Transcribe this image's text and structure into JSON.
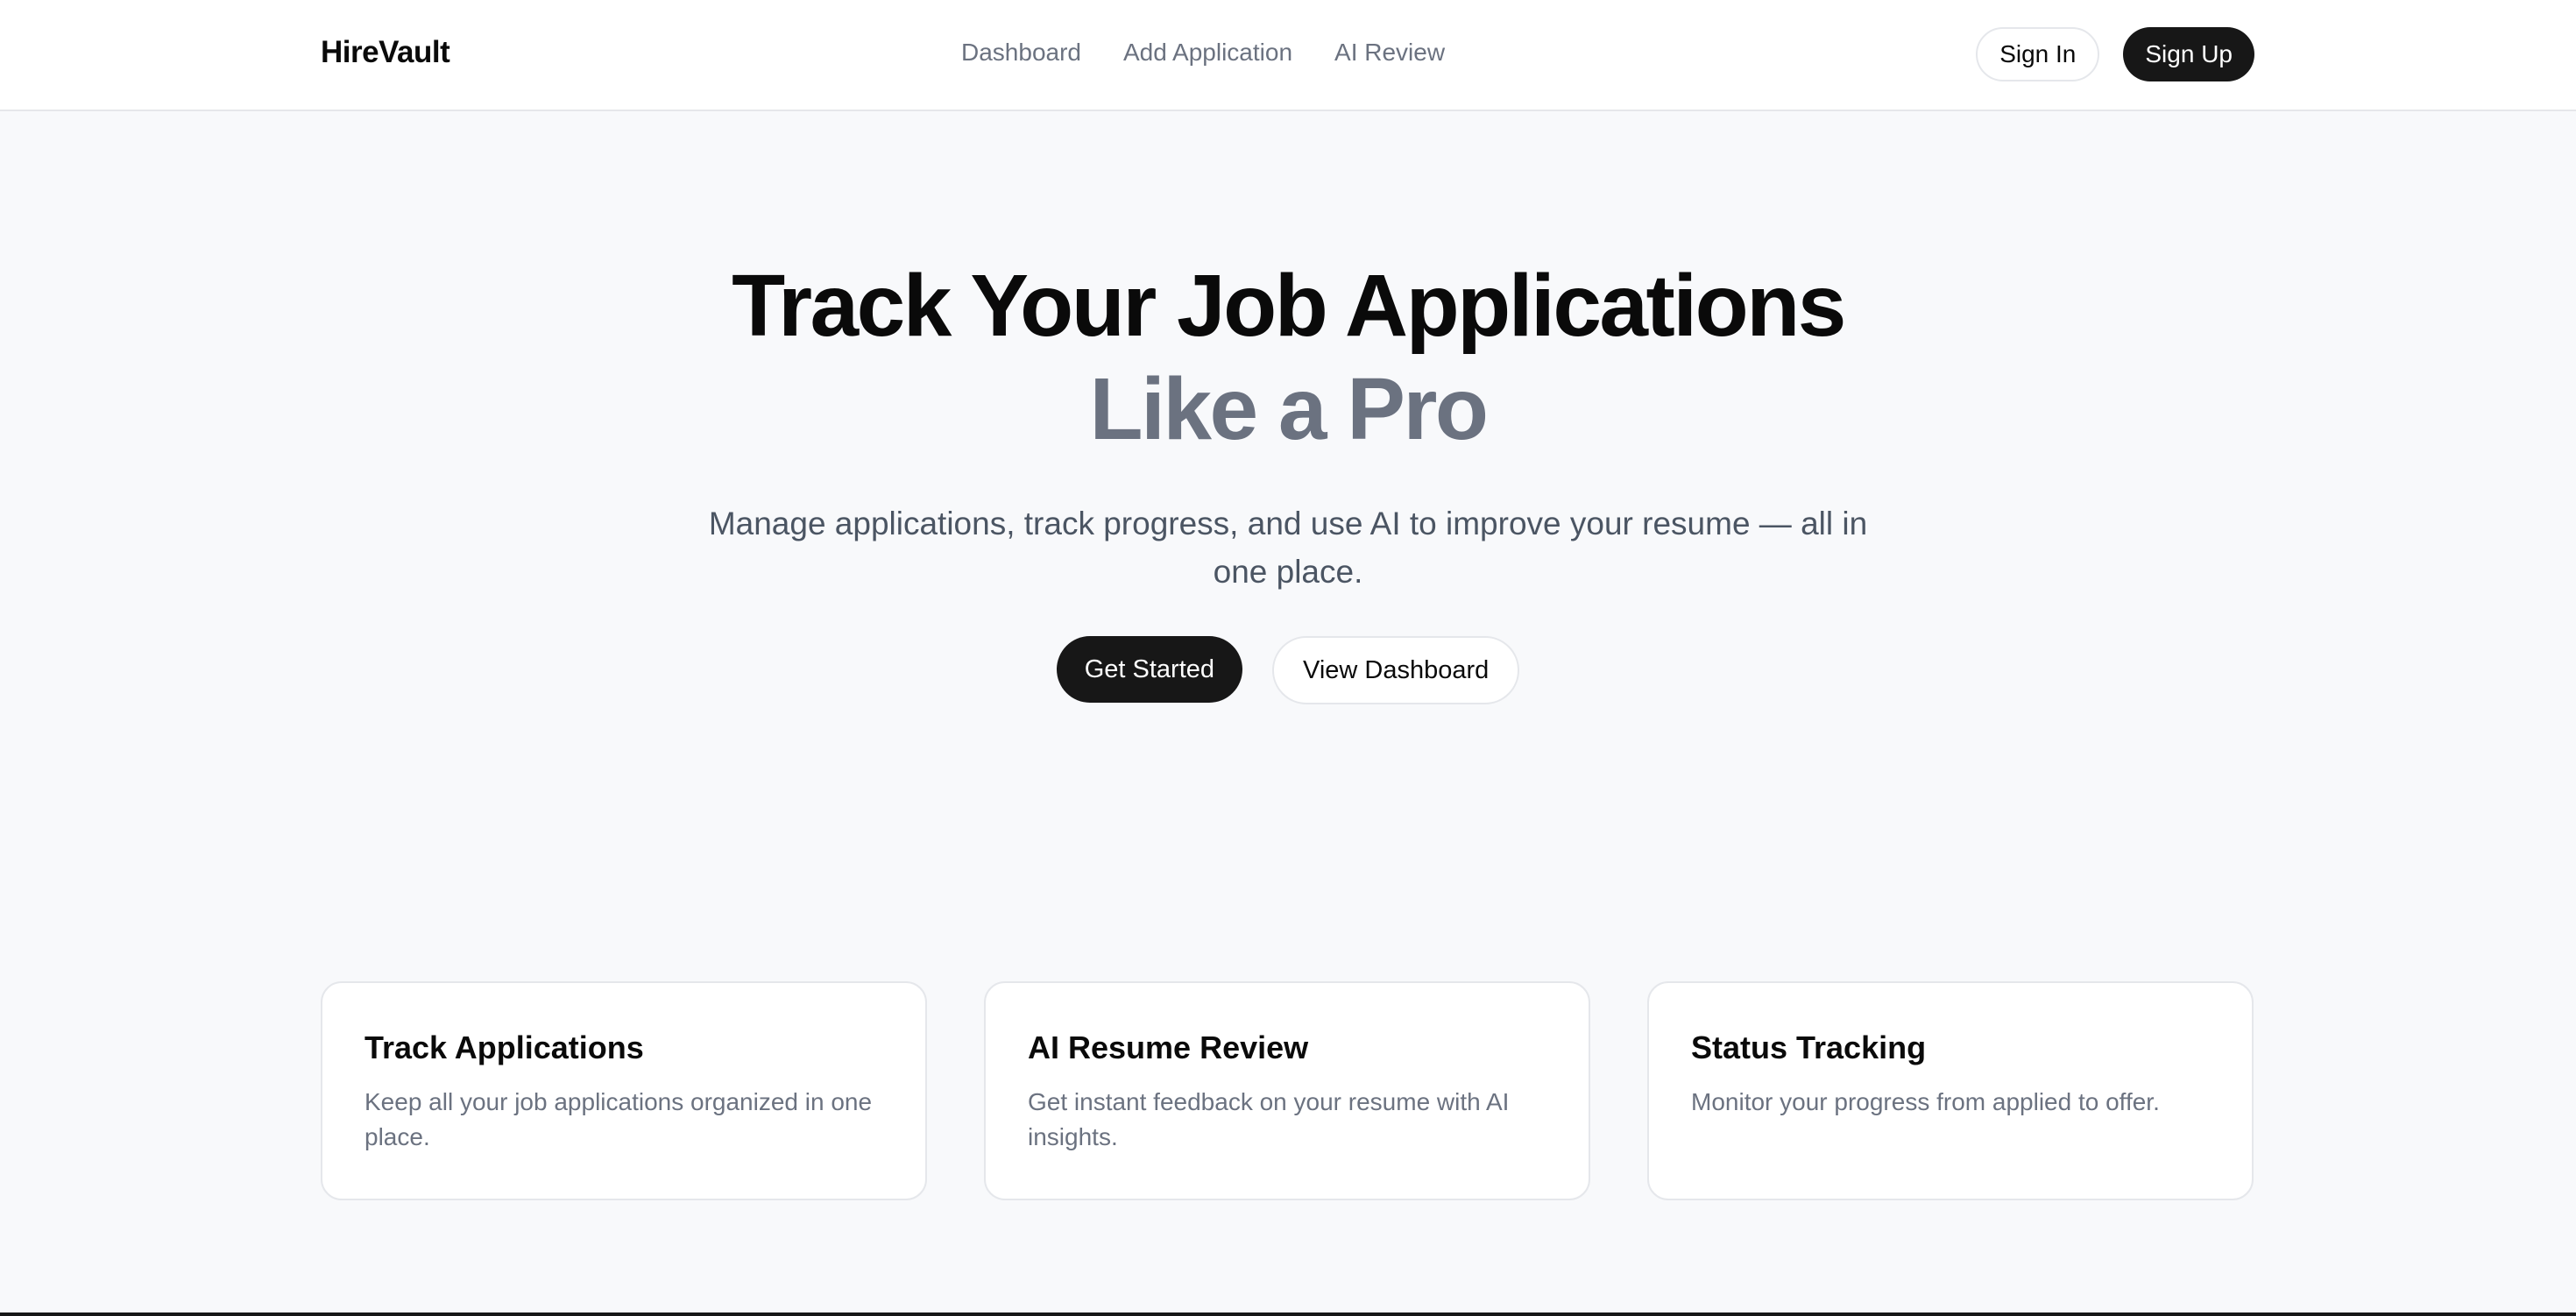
{
  "header": {
    "brand": "HireVault",
    "nav": [
      {
        "label": "Dashboard"
      },
      {
        "label": "Add Application"
      },
      {
        "label": "AI Review"
      }
    ],
    "sign_in_label": "Sign In",
    "sign_up_label": "Sign Up"
  },
  "hero": {
    "title_line1": "Track Your Job Applications",
    "title_line2": "Like a Pro",
    "subtitle": "Manage applications, track progress, and use AI to improve your resume — all in one place.",
    "primary_cta": "Get Started",
    "secondary_cta": "View Dashboard"
  },
  "features": [
    {
      "title": "Track Applications",
      "description": "Keep all your job applications organized in one place."
    },
    {
      "title": "AI Resume Review",
      "description": "Get instant feedback on your resume with AI insights."
    },
    {
      "title": "Status Tracking",
      "description": "Monitor your progress from applied to offer."
    }
  ],
  "colors": {
    "background": "#f8f9fb",
    "surface": "#ffffff",
    "primary": "#171717",
    "text": "#0a0a0a",
    "muted": "#6b7280",
    "border": "#e5e7eb"
  }
}
